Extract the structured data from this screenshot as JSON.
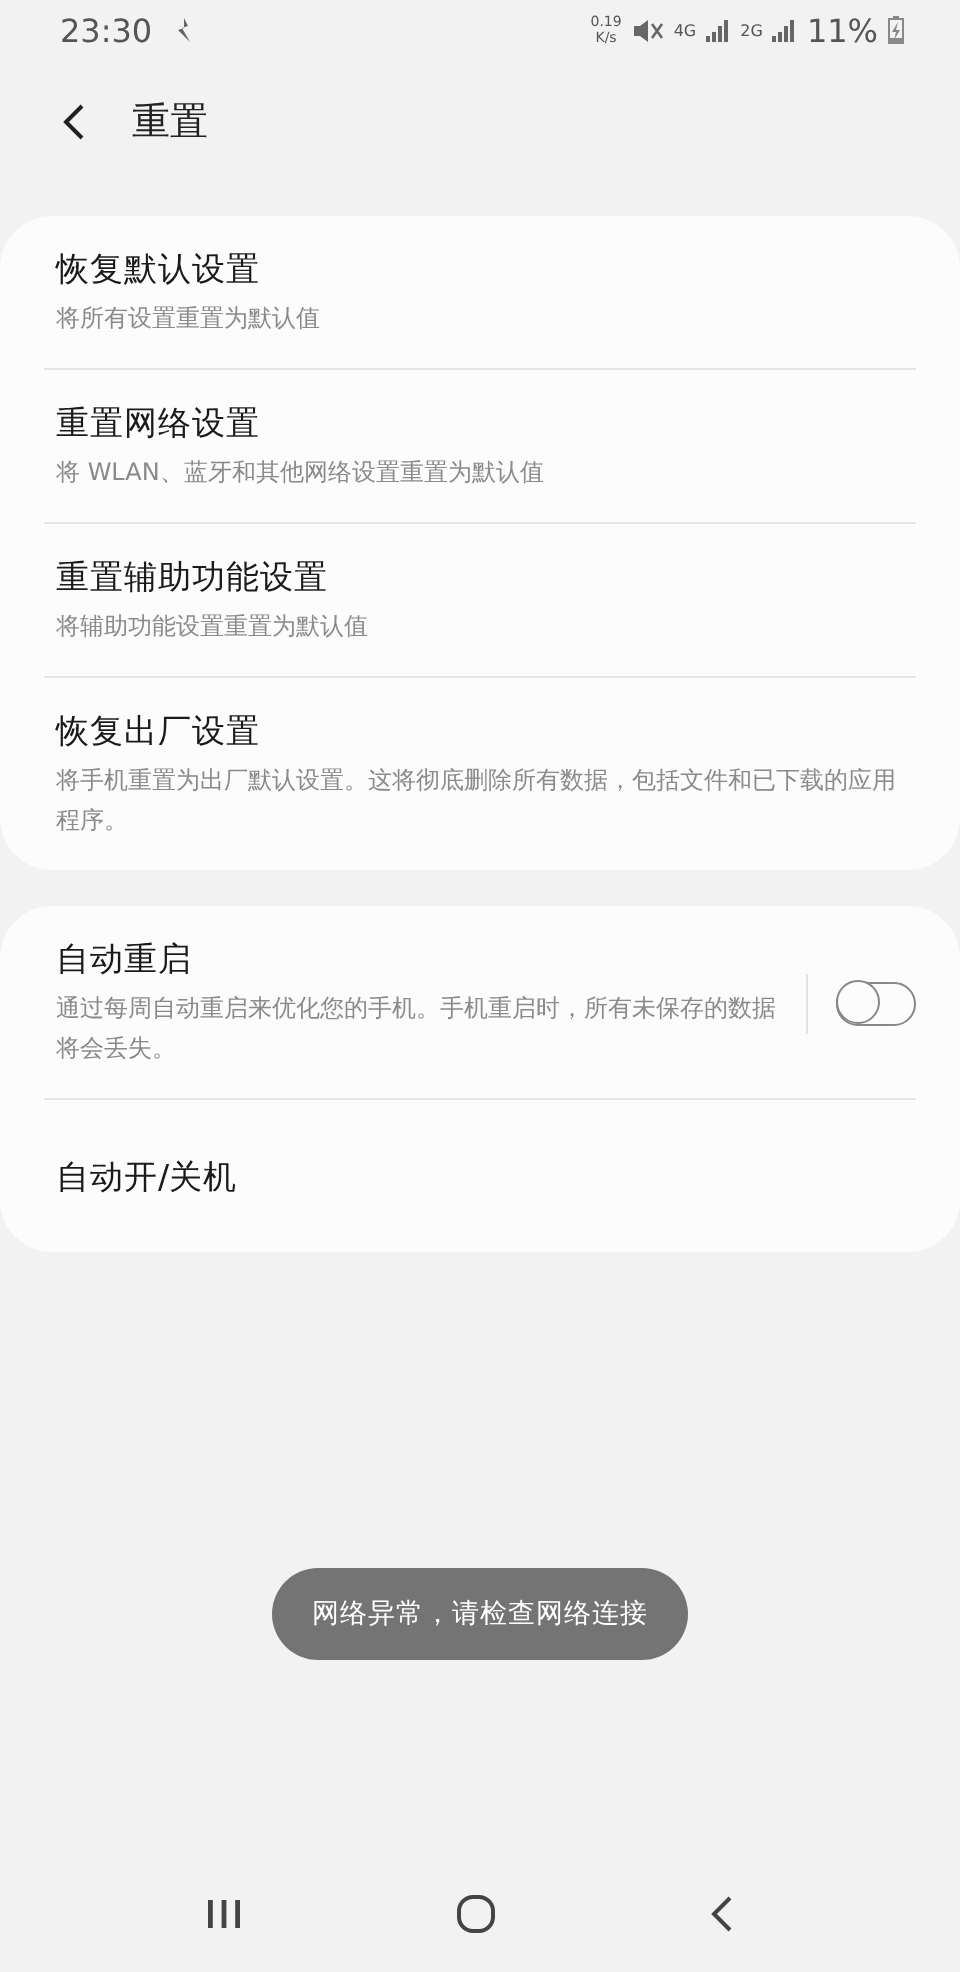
{
  "status_bar": {
    "time": "23:30",
    "net_speed": "0.19",
    "net_speed_unit": "K/s",
    "network_1": "4G",
    "network_2": "2G",
    "battery": "11%"
  },
  "header": {
    "title": "重置"
  },
  "groups": [
    {
      "items": [
        {
          "kind": "plain",
          "title": "恢复默认设置",
          "subtitle": "将所有设置重置为默认值"
        },
        {
          "kind": "plain",
          "title": "重置网络设置",
          "subtitle": "将 WLAN、蓝牙和其他网络设置重置为默认值"
        },
        {
          "kind": "plain",
          "title": "重置辅助功能设置",
          "subtitle": "将辅助功能设置重置为默认值"
        },
        {
          "kind": "plain",
          "title": "恢复出厂设置",
          "subtitle": "将手机重置为出厂默认设置。这将彻底删除所有数据，包括文件和已下载的应用程序。"
        }
      ]
    },
    {
      "items": [
        {
          "kind": "toggle",
          "title": "自动重启",
          "subtitle": "通过每周自动重启来优化您的手机。手机重启时，所有未保存的数据将会丢失。",
          "on": false
        },
        {
          "kind": "plain",
          "title": "自动开/关机"
        }
      ]
    }
  ],
  "toast": "网络异常，请检查网络连接"
}
